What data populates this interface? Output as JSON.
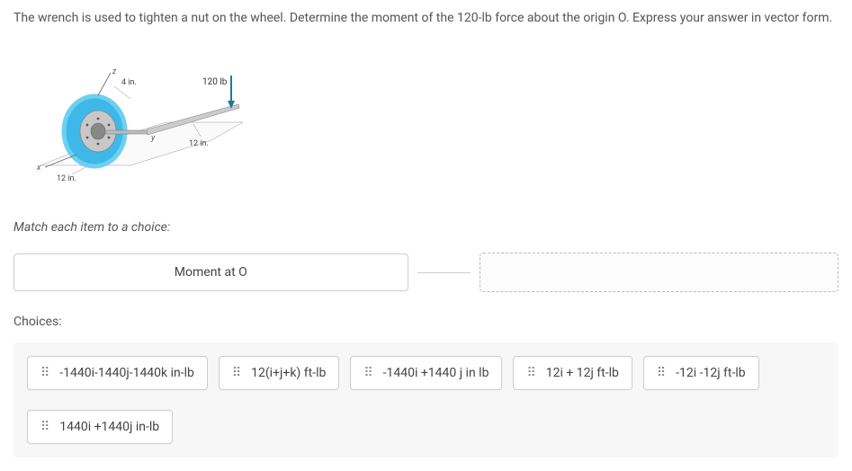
{
  "question": "The wrench is used to tighten a nut on the wheel. Determine the moment of the 120-lb force about the origin O. Express your answer in vector form.",
  "diagram": {
    "z_label": "z",
    "x_label": "x",
    "y_label": "y",
    "dim_top": "4 in.",
    "dim_left": "12 in.",
    "dim_right": "12 in.",
    "force": "120 lb"
  },
  "instruction": "Match each item to a choice:",
  "match_item": "Moment at O",
  "choices_label": "Choices:",
  "choices": [
    "-1440i-1440j-1440k in-lb",
    "12(i+j+k) ft-lb",
    "-1440i +1440 j in lb",
    "12i + 12j ft-lb",
    "-12i -12j ft-lb",
    "1440i +1440j in-lb"
  ]
}
